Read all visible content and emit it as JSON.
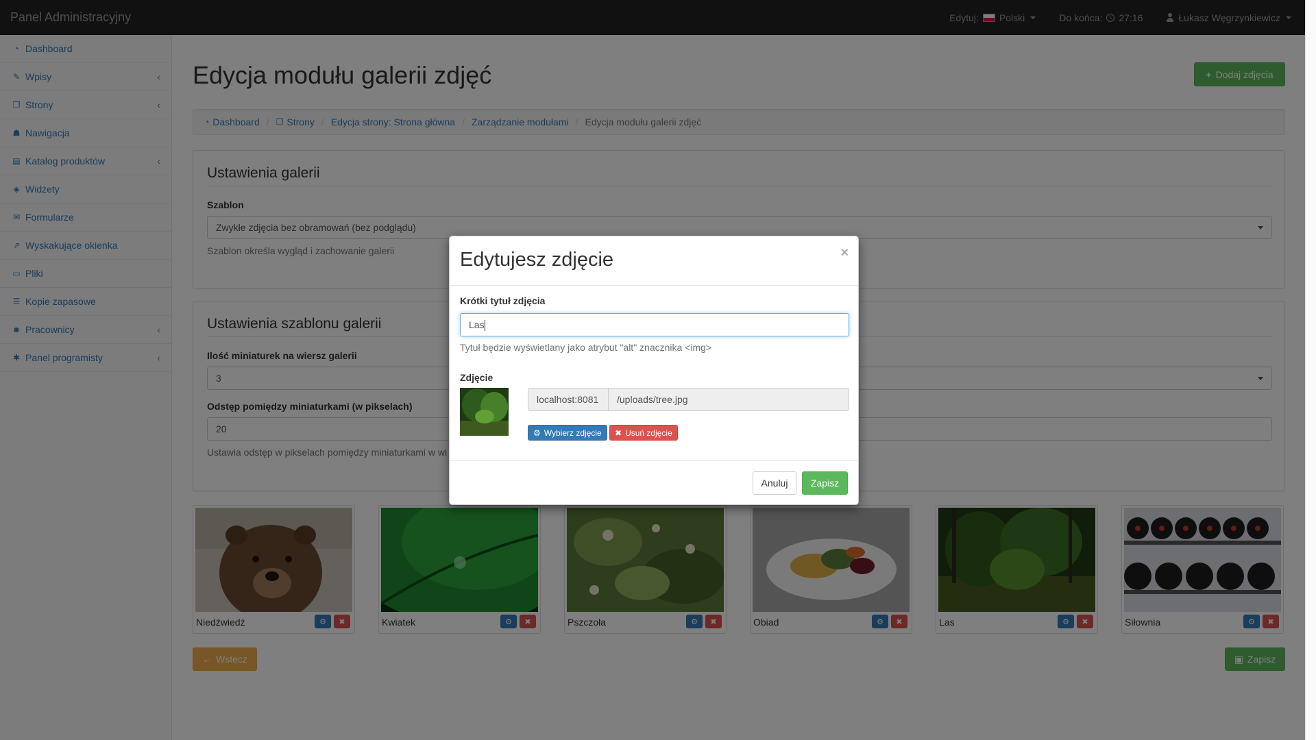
{
  "navbar": {
    "brand": "Panel Administracyjny",
    "edit_label": "Edytuj:",
    "language": "Polski",
    "until_end_label": "Do końca:",
    "timer": "27:16",
    "user": "Łukasz Węgrzynkiewicz"
  },
  "sidebar": {
    "items": [
      {
        "label": "Dashboard",
        "icon": "dashboard-icon",
        "has_arrow": false
      },
      {
        "label": "Wpisy",
        "icon": "edit-icon",
        "has_arrow": true
      },
      {
        "label": "Strony",
        "icon": "pages-icon",
        "has_arrow": true
      },
      {
        "label": "Nawigacja",
        "icon": "sitemap-icon",
        "has_arrow": false
      },
      {
        "label": "Katalog produktów",
        "icon": "basket-icon",
        "has_arrow": true
      },
      {
        "label": "Widżety",
        "icon": "cube-icon",
        "has_arrow": false
      },
      {
        "label": "Formularze",
        "icon": "envelope-icon",
        "has_arrow": false
      },
      {
        "label": "Wyskakujące okienka",
        "icon": "external-link-icon",
        "has_arrow": false
      },
      {
        "label": "Pliki",
        "icon": "folder-icon",
        "has_arrow": false
      },
      {
        "label": "Kopie zapasowe",
        "icon": "database-icon",
        "has_arrow": false
      },
      {
        "label": "Pracownicy",
        "icon": "users-icon",
        "has_arrow": true
      },
      {
        "label": "Panel programisty",
        "icon": "bug-icon",
        "has_arrow": true
      }
    ]
  },
  "page": {
    "title": "Edycja modułu galerii zdjęć",
    "add_button": "Dodaj zdjęcia",
    "back_button": "Wstecz",
    "save_button": "Zapisz"
  },
  "breadcrumb": {
    "items": [
      "Dashboard",
      "Strony",
      "Edycja strony: Strona główna",
      "Zarządzanie modułami"
    ],
    "active": "Edycja modułu galerii zdjęć"
  },
  "gallery_settings": {
    "legend": "Ustawienia galerii",
    "template_label": "Szablon",
    "template_value": "Zwykłe zdjęcia bez obramowań (bez podglądu)",
    "template_help": "Szablon określa wygląd i zachowanie galerii"
  },
  "template_settings": {
    "legend": "Ustawienia szablonu galerii",
    "thumbs_label": "Ilość miniaturek na wiersz galerii",
    "thumbs_value": "3",
    "spacing_label": "Odstęp pomiędzy miniaturkami (w pikselach)",
    "spacing_value": "20",
    "spacing_help": "Ustawia odstęp w pikselach pomiędzy miniaturkami w wi"
  },
  "thumbnails": [
    {
      "caption": "Niedźwiedź"
    },
    {
      "caption": "Kwiatek"
    },
    {
      "caption": "Pszczoła"
    },
    {
      "caption": "Obiad"
    },
    {
      "caption": "Las"
    },
    {
      "caption": "Siłownia"
    }
  ],
  "modal": {
    "title": "Edytujesz zdjęcie",
    "close": "×",
    "title_label": "Krótki tytuł zdjęcia",
    "title_value": "Las",
    "title_help": "Tytuł będzie wyświetlany jako atrybut \"alt\" znacznika <img>",
    "image_label": "Zdjęcie",
    "host": "localhost:8081",
    "path": "/uploads/tree.jpg",
    "choose_button": "Wybierz zdjęcie",
    "remove_button": "Usuń zdjęcie",
    "cancel_button": "Anuluj",
    "save_button": "Zapisz"
  },
  "colors": {
    "primary": "#337ab7",
    "success": "#5cb85c",
    "danger": "#d9534f",
    "warning": "#f0ad4e",
    "navbar": "#222222"
  }
}
